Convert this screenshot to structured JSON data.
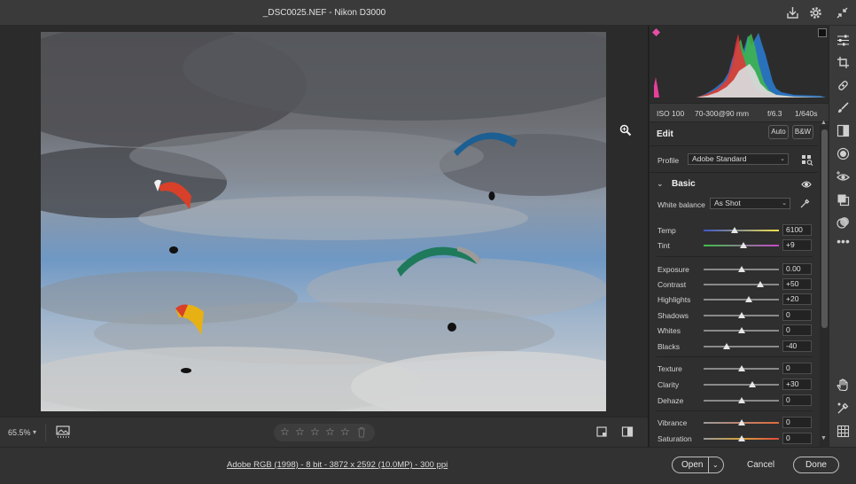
{
  "window": {
    "title": "_DSC0025.NEF  -  Nikon D3000"
  },
  "exif": {
    "iso": "ISO 100",
    "lens": "70-300@90 mm",
    "aperture": "f/6.3",
    "shutter": "1/640s"
  },
  "edit": {
    "title": "Edit",
    "auto_label": "Auto",
    "bw_label": "B&W",
    "profile_label": "Profile",
    "profile_value": "Adobe Standard"
  },
  "basic": {
    "title": "Basic",
    "white_balance_label": "White balance",
    "white_balance_value": "As Shot",
    "sliders": [
      {
        "label": "Temp",
        "value": "6100",
        "pos": 0.41
      },
      {
        "label": "Tint",
        "value": "+9",
        "pos": 0.53
      },
      {
        "label": "Exposure",
        "value": "0.00",
        "pos": 0.5
      },
      {
        "label": "Contrast",
        "value": "+50",
        "pos": 0.75
      },
      {
        "label": "Highlights",
        "value": "+20",
        "pos": 0.6
      },
      {
        "label": "Shadows",
        "value": "0",
        "pos": 0.5
      },
      {
        "label": "Whites",
        "value": "0",
        "pos": 0.5
      },
      {
        "label": "Blacks",
        "value": "-40",
        "pos": 0.3
      },
      {
        "label": "Texture",
        "value": "0",
        "pos": 0.5
      },
      {
        "label": "Clarity",
        "value": "+30",
        "pos": 0.65
      },
      {
        "label": "Dehaze",
        "value": "0",
        "pos": 0.5
      },
      {
        "label": "Vibrance",
        "value": "0",
        "pos": 0.5
      },
      {
        "label": "Saturation",
        "value": "0",
        "pos": 0.5
      }
    ]
  },
  "bottom": {
    "zoom": "65.5%"
  },
  "footer": {
    "file_info": "Adobe RGB (1998) - 8 bit - 3872 x 2592 (10.0MP) - 300 ppi",
    "open_label": "Open",
    "cancel_label": "Cancel",
    "done_label": "Done"
  },
  "colors": {
    "accent": "#e8e8e8",
    "panel_bg": "#2f2f2f",
    "chrome_bg": "#3a3a3a",
    "sky": "#6f98c4"
  },
  "icons": [
    "save-icon",
    "gear-icon",
    "collapse-icon",
    "edit-sliders-icon",
    "crop-icon",
    "healing-icon",
    "brush-icon",
    "gradient-icon",
    "radial-icon",
    "redeye-icon",
    "presets-icon",
    "snapshots-icon",
    "more-icon",
    "hand-icon",
    "sampler-icon",
    "grid-icon"
  ]
}
